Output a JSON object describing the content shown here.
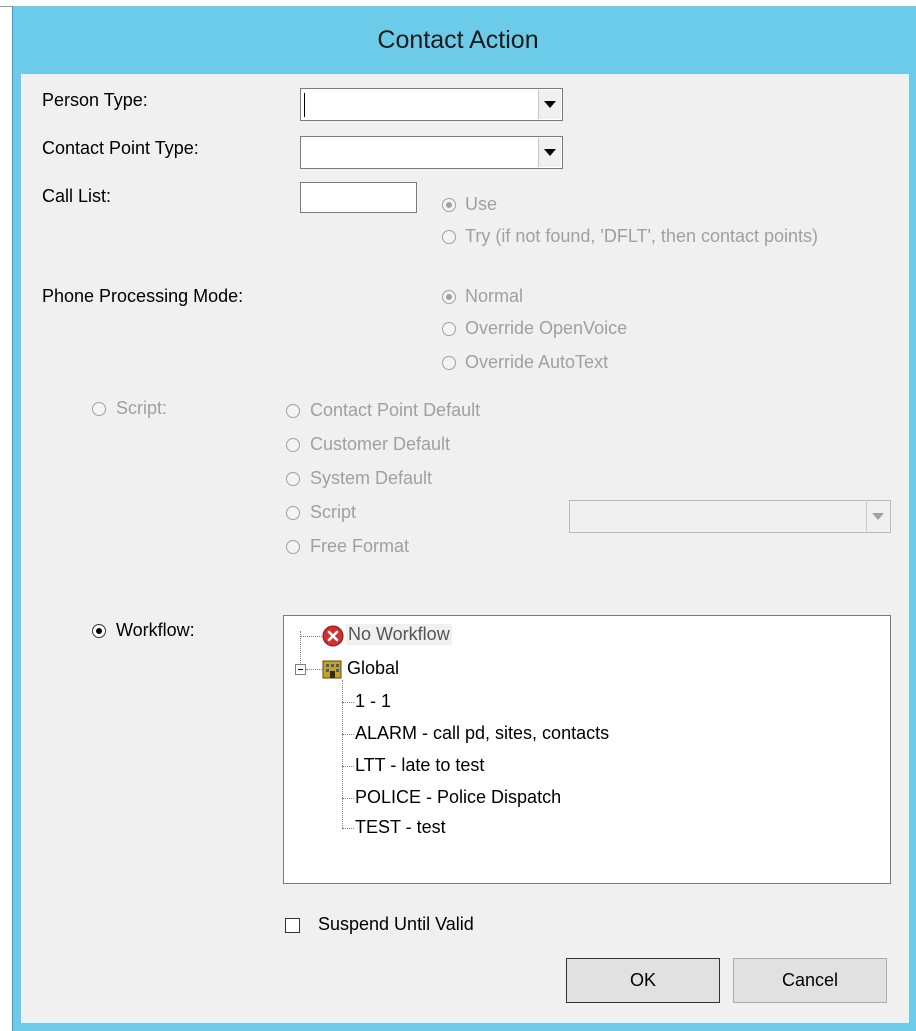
{
  "dialog": {
    "title": "Contact Action"
  },
  "fields": {
    "person_type_label": "Person Type:",
    "person_type_value": "",
    "contact_point_type_label": "Contact Point Type:",
    "contact_point_type_value": "",
    "call_list_label": "Call List:",
    "call_list_value": "",
    "call_list_options": [
      "Use",
      "Try (if not found, 'DFLT', then contact points)"
    ],
    "phone_mode_label": "Phone Processing Mode:",
    "phone_mode_options": [
      "Normal",
      "Override OpenVoice",
      "Override AutoText"
    ]
  },
  "script": {
    "label": "Script:",
    "options": [
      "Contact Point Default",
      "Customer Default",
      "System Default",
      "Script",
      "Free Format"
    ],
    "script_select_value": ""
  },
  "workflow": {
    "label": "Workflow:",
    "tree": {
      "no_workflow": "No Workflow",
      "global": "Global",
      "children": [
        "1 - 1",
        "ALARM - call pd, sites, contacts",
        "LTT - late to test",
        "POLICE - Police Dispatch",
        "TEST - test"
      ]
    }
  },
  "suspend": {
    "label": "Suspend Until Valid",
    "checked": false
  },
  "buttons": {
    "ok": "OK",
    "cancel": "Cancel"
  },
  "icons": {
    "no_workflow": "error-x-icon",
    "global": "building-icon"
  },
  "colors": {
    "titlebar": "#6ccbe8",
    "client": "#f0f0f0",
    "disabled_text": "#a0a0a0"
  }
}
